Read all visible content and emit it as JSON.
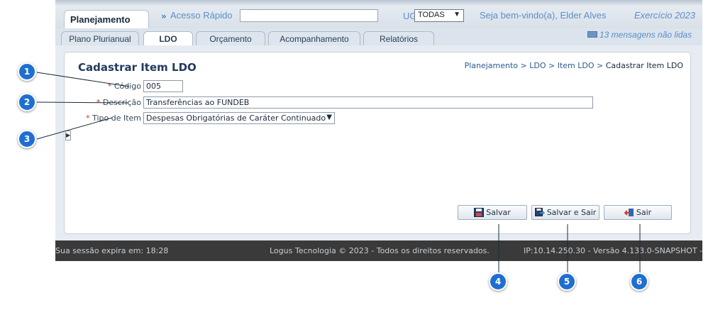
{
  "header": {
    "module_tab": "Planejamento",
    "quick_access_arrow": "»",
    "quick_access_label": "Acesso Rápido",
    "quick_access_value": "",
    "ug_label": "UG",
    "ug_selected": "TODAS",
    "welcome": "Seja bem-vindo(a), Elder Alves",
    "exercicio": "Exercício 2023",
    "messages": "13 mensagens não lidas"
  },
  "tabs": [
    {
      "label": "Plano Plurianual"
    },
    {
      "label": "LDO"
    },
    {
      "label": "Orçamento"
    },
    {
      "label": "Acompanhamento"
    },
    {
      "label": "Relatórios"
    }
  ],
  "page": {
    "title": "Cadastrar Item LDO",
    "breadcrumb_links": "Planejamento > LDO > Item LDO > ",
    "breadcrumb_current": "Cadastrar Item LDO"
  },
  "form": {
    "required_marker": "*",
    "codigo_label": "Código",
    "codigo_value": "005",
    "descricao_label": "Descrição",
    "descricao_value": "Transferências ao FUNDEB",
    "tipo_label": "Tipo de Item",
    "tipo_value": "Despesas Obrigatórias de Caráter Continuado"
  },
  "buttons": {
    "save": "Salvar",
    "save_exit": "Salvar e Sair",
    "exit": "Sair"
  },
  "footer": {
    "session": "Sua sessão expira em: 18:28",
    "copyright": "Logus Tecnologia © 2023 - Todos os direitos reservados.",
    "version": "IP:10.14.250.30 - Versão 4.133.0-SNAPSHOT -"
  },
  "callouts": [
    "1",
    "2",
    "3",
    "4",
    "5",
    "6"
  ],
  "icons": {
    "quick_access": "double-chevron-right-icon",
    "ug_dropdown": "chevron-down-icon",
    "messages": "mail-icon",
    "save": "floppy-disk-icon",
    "save_exit": "floppy-exit-icon",
    "exit": "exit-door-icon",
    "side_toggle": "triangle-right-icon"
  },
  "colors": {
    "callout": "#1f6fd1",
    "title": "#233a5c",
    "link": "#5b8fc9",
    "footer_bg": "#3a3a3a"
  }
}
